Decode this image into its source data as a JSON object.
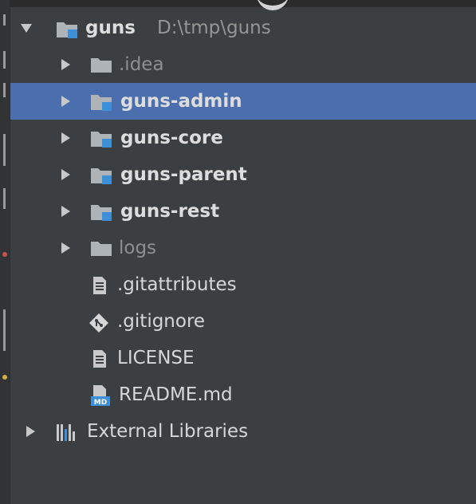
{
  "colors": {
    "background": "#3c3f41",
    "selection": "#4b6eaf",
    "module_badge": "#3d8fd8",
    "folder_gray": "#aeb3b8",
    "text": "#d7d7d7",
    "muted_text": "#8d8f91"
  },
  "tree": {
    "root": {
      "name": "guns",
      "path": "D:\\tmp\\guns",
      "icon": "module-folder-icon",
      "expanded": true
    },
    "children": [
      {
        "name": ".idea",
        "icon": "folder-icon",
        "kind": "folder"
      },
      {
        "name": "guns-admin",
        "icon": "module-folder-icon",
        "kind": "module",
        "selected": true
      },
      {
        "name": "guns-core",
        "icon": "module-folder-icon",
        "kind": "module"
      },
      {
        "name": "guns-parent",
        "icon": "module-folder-icon",
        "kind": "module"
      },
      {
        "name": "guns-rest",
        "icon": "module-folder-icon",
        "kind": "module"
      },
      {
        "name": "logs",
        "icon": "folder-icon",
        "kind": "folder"
      },
      {
        "name": ".gitattributes",
        "icon": "text-file-icon",
        "kind": "file"
      },
      {
        "name": ".gitignore",
        "icon": "git-diamond-icon",
        "kind": "file"
      },
      {
        "name": "LICENSE",
        "icon": "text-file-icon",
        "kind": "file"
      },
      {
        "name": "README.md",
        "icon": "markdown-file-icon",
        "kind": "file"
      }
    ],
    "external_libraries": {
      "name": "External Libraries",
      "icon": "library-bars-icon"
    }
  }
}
